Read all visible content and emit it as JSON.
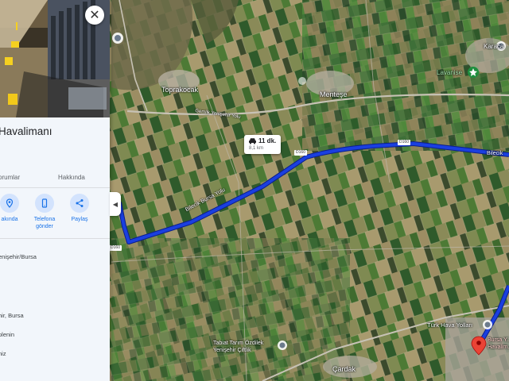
{
  "map": {
    "places": [
      {
        "name": "Toprakocak"
      },
      {
        "name": "Menteşe"
      },
      {
        "name": "Lavanise"
      },
      {
        "name": "Karaca"
      },
      {
        "name": "Türk Hava Yolları"
      },
      {
        "name": "Tabiat Tarım Özdilek\nYenişehir Çiftlik"
      },
      {
        "name": "Çardak"
      },
      {
        "name": "Bursa Y...\nHavalim..."
      }
    ],
    "roads": {
      "gemlik": "Gemlik Yenişehir Yolu",
      "bilecik": "Bilecik Bursa Yolu",
      "bilecik_right": "Bilecik",
      "shield_1": "D160",
      "shield_2": "D160",
      "shield_3": "D160"
    },
    "route": {
      "time": "11 dk.",
      "distance": "8,1 km",
      "color": "#1a3fe0"
    },
    "accent": "#ea4335"
  },
  "panel": {
    "title": "Havalimanı",
    "tabs": [
      "orumlar",
      "Hakkında"
    ],
    "actions": [
      {
        "icon": "location-pin-icon",
        "label": "akında"
      },
      {
        "icon": "phone-send-icon",
        "label": "Telefona\ngönder"
      },
      {
        "icon": "share-icon",
        "label": "Paylaş"
      }
    ],
    "info": [
      "enişehir/Bursa",
      "hir, Bursa",
      "plenin",
      "niz"
    ],
    "close": "✕",
    "collapse": "◀"
  }
}
